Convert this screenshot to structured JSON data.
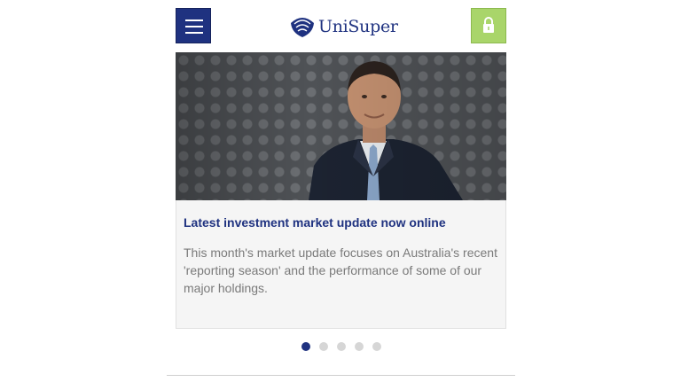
{
  "header": {
    "menu_icon": "hamburger-menu-icon",
    "logo_text": "UniSuper",
    "lock_icon": "lock-icon"
  },
  "colors": {
    "brand_blue": "#1f3280",
    "lock_green": "#a9d56a",
    "body_text": "#7a7a7a",
    "card_background": "#f5f5f5"
  },
  "carousel": {
    "slide": {
      "title": "Latest investment market update now online",
      "body": "This month's market update focuses on Australia's recent 'reporting season' and the performance of some of our major holdings."
    },
    "slide_count": 5,
    "active_index": 1
  }
}
